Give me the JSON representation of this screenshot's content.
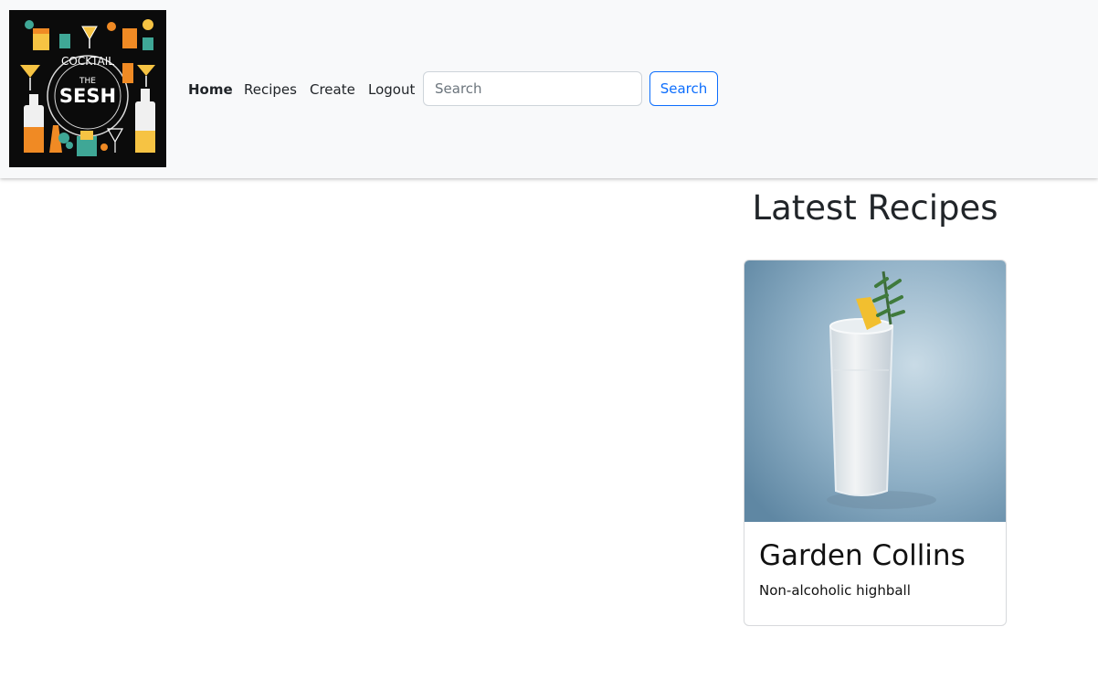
{
  "logo": {
    "top_text": "COCKTAIL",
    "the_text": "THE",
    "name_text": "SESH",
    "colors": {
      "background": "#0b0b0b",
      "orange": "#f08a24",
      "yellow": "#f6c343",
      "teal": "#3fa796",
      "white": "#ffffff"
    }
  },
  "nav": {
    "links": [
      {
        "label": "Home",
        "active": true
      },
      {
        "label": "Recipes"
      },
      {
        "label": "Create"
      },
      {
        "label": "Logout"
      }
    ]
  },
  "search": {
    "placeholder": "Search",
    "button_label": "Search"
  },
  "main": {
    "section_title": "Latest Recipes",
    "cards": [
      {
        "title": "Garden Collins",
        "description": "Non-alcoholic highball"
      }
    ]
  },
  "colors": {
    "navbar_bg": "#f8f9fa",
    "primary": "#0d6efd",
    "text": "#212529"
  }
}
